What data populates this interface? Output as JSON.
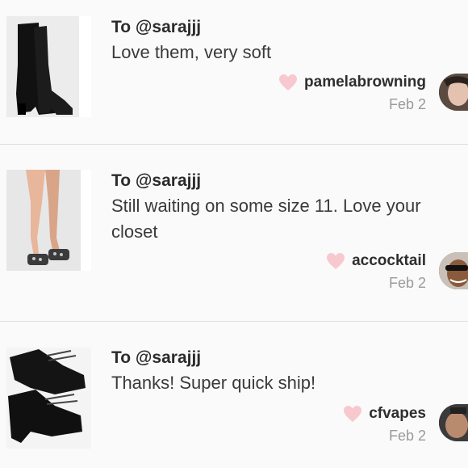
{
  "comments": [
    {
      "to": "To @sarajjj",
      "message": "Love them, very soft",
      "username": "pamelabrowning",
      "date": "Feb 2",
      "image": "black-over-the-knee-heel-boots",
      "avatar": "user-avatar-photo"
    },
    {
      "to": "To @sarajjj",
      "message": "Still waiting on some size 11. Love your closet",
      "username": "accocktail",
      "date": "Feb 2",
      "image": "embellished-slide-sandals",
      "avatar": "user-avatar-sunglasses"
    },
    {
      "to": "To @sarajjj",
      "message": "Thanks! Super quick ship!",
      "username": "cfvapes",
      "date": "Feb 2",
      "image": "black-lace-up-ankle-boots",
      "avatar": "user-avatar-photo"
    }
  ],
  "colors": {
    "heart": "#f7c9cf",
    "divider": "#dedede",
    "date": "#9a9a9a"
  }
}
